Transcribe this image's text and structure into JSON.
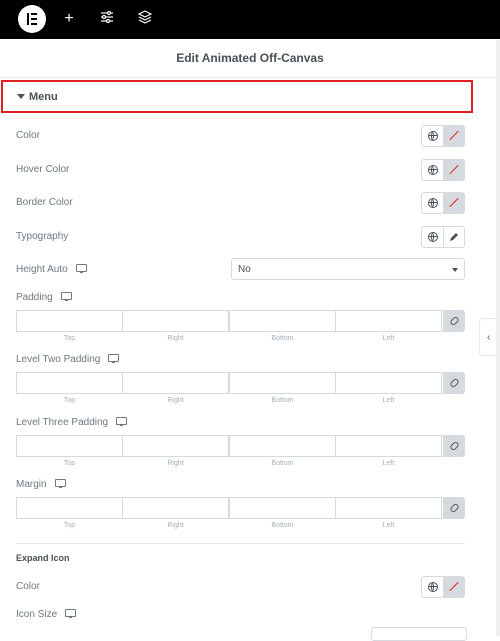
{
  "topbar": {
    "icons": [
      "elementor-logo-icon",
      "plus-icon",
      "sliders-icon",
      "layers-icon"
    ]
  },
  "header": {
    "title": "Edit Animated Off-Canvas"
  },
  "section": {
    "label": "Menu"
  },
  "fields": {
    "color": "Color",
    "hover_color": "Hover Color",
    "border_color": "Border Color",
    "typography": "Typography",
    "height_auto": "Height Auto",
    "height_auto_value": "No",
    "padding": "Padding",
    "level_two_padding": "Level Two Padding",
    "level_three_padding": "Level Three Padding",
    "margin": "Margin"
  },
  "dimension_labels": {
    "top": "Top",
    "right": "Right",
    "bottom": "Bottom",
    "left": "Left"
  },
  "expand_icon": {
    "heading": "Expand Icon",
    "color": "Color",
    "icon_size": "Icon Size"
  },
  "colors": {
    "accent": "#e02020",
    "text": "#6d7882",
    "heading": "#495157",
    "border": "#d5dadf"
  }
}
